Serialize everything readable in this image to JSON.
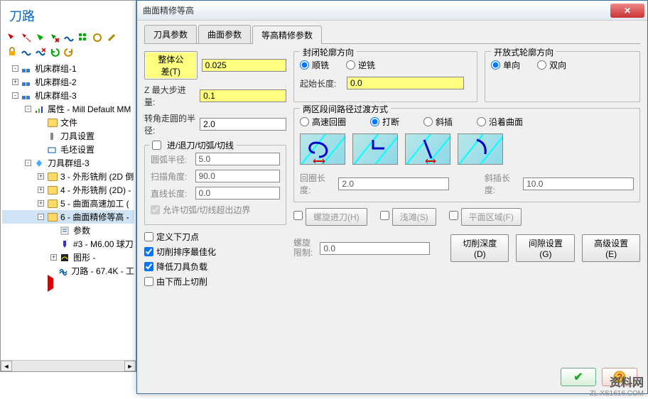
{
  "left_panel": {
    "title": "刀路",
    "tree": [
      {
        "indent": 12,
        "exp": "-",
        "label": "机床群组-1",
        "icon": "shapes"
      },
      {
        "indent": 12,
        "exp": "+",
        "label": "机床群组-2",
        "icon": "shapes"
      },
      {
        "indent": 12,
        "exp": "-",
        "label": "机床群组-3",
        "icon": "shapes"
      },
      {
        "indent": 30,
        "exp": "-",
        "label": "属性 - Mill Default MM",
        "icon": "prop"
      },
      {
        "indent": 48,
        "exp": "",
        "label": "文件",
        "icon": "folder"
      },
      {
        "indent": 48,
        "exp": "",
        "label": "刀具设置",
        "icon": "tool"
      },
      {
        "indent": 48,
        "exp": "",
        "label": "毛坯设置",
        "icon": "stock"
      },
      {
        "indent": 30,
        "exp": "-",
        "label": "刀具群组-3",
        "icon": "toolgrp"
      },
      {
        "indent": 48,
        "exp": "+",
        "label": "3 - 外形铣削 (2D 倒",
        "icon": "folder"
      },
      {
        "indent": 48,
        "exp": "+",
        "label": "4 - 外形铣削 (2D) - ",
        "icon": "folder"
      },
      {
        "indent": 48,
        "exp": "+",
        "label": "5 - 曲面高速加工 (",
        "icon": "folder"
      },
      {
        "indent": 48,
        "exp": "-",
        "label": "6 - 曲面精修等高 -",
        "icon": "folder-sel",
        "sel": true
      },
      {
        "indent": 66,
        "exp": "",
        "label": "参数",
        "icon": "param"
      },
      {
        "indent": 66,
        "exp": "",
        "label": "#3 - M6.00 球刀",
        "icon": "bit"
      },
      {
        "indent": 66,
        "exp": "+",
        "label": "图形 -",
        "icon": "geom"
      },
      {
        "indent": 66,
        "exp": "",
        "label": "刀路 - 67.4K - 工",
        "icon": "nc"
      },
      {
        "indent": 48,
        "exp": "",
        "label": "",
        "icon": "redtri"
      }
    ]
  },
  "dialog": {
    "title": "曲面精修等高",
    "tabs": [
      "刀具参数",
      "曲面参数",
      "等高精修参数"
    ],
    "tolerance_btn": "整体公差(T)",
    "tolerance_val": "0.025",
    "z_step_lbl": "Z 最大步进量:",
    "z_step_val": "0.1",
    "corner_lbl": "转角走圆的半径:",
    "corner_val": "2.0",
    "entry_group": "进/退刀/切弧/切线",
    "arc_radius_lbl": "圆弧半径:",
    "arc_radius_val": "5.0",
    "sweep_lbl": "扫描角度:",
    "sweep_val": "90.0",
    "line_lbl": "直线长度:",
    "line_val": "0.0",
    "allow_cutout": "允许切弧/切线超出边界",
    "def_down": "定义下刀点",
    "opt_order": "切削排序最佳化",
    "reduce_load": "降低刀具负载",
    "bottom_up": "由下而上切削",
    "closed_dir_title": "封闭轮廓方向",
    "climb": "顺铣",
    "conventional": "逆铣",
    "start_len_lbl": "起始长度:",
    "start_len_val": "0.0",
    "open_dir_title": "开放式轮廓方向",
    "single": "单向",
    "double": "双向",
    "between_title": "两区段间路径过渡方式",
    "trans_hsloop": "高速回圈",
    "trans_break": "打断",
    "trans_ramp": "斜插",
    "trans_follow": "沿着曲面",
    "loop_len_lbl": "回圈长度:",
    "loop_len_val": "2.0",
    "ramp_len_lbl": "斜插长度:",
    "ramp_len_val": "10.0",
    "helix_entry": "螺旋进刀(H)",
    "shallow": "浅滩(S)",
    "flat_area": "平面区域(F)",
    "helix_limit_lbl": "螺旋\n限制:",
    "helix_limit_val": "0.0",
    "depth_btn": "切削深度(D)",
    "gap_btn": "间隙设置(G)",
    "adv_btn": "高级设置(E)"
  },
  "watermark": {
    "l1": "资料网",
    "l2": "ZL.XS1616.COM"
  }
}
